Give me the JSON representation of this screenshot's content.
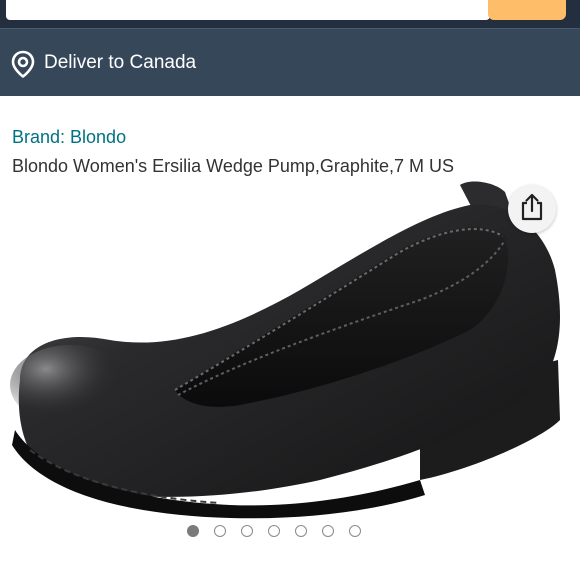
{
  "header": {
    "deliver_text": "Deliver to Canada",
    "location_icon": "location-pin-icon"
  },
  "product": {
    "brand": "Brand: Blondo",
    "title": "Blondo Women's Ersilia Wedge Pump,Graphite,7 M US",
    "share_icon": "share-icon"
  },
  "carousel": {
    "total_images": 7,
    "active_index": 0
  },
  "colors": {
    "header_bg": "#232f3e",
    "deliver_bg": "#37475a",
    "search_button": "#febd69",
    "brand_link": "#007185"
  }
}
